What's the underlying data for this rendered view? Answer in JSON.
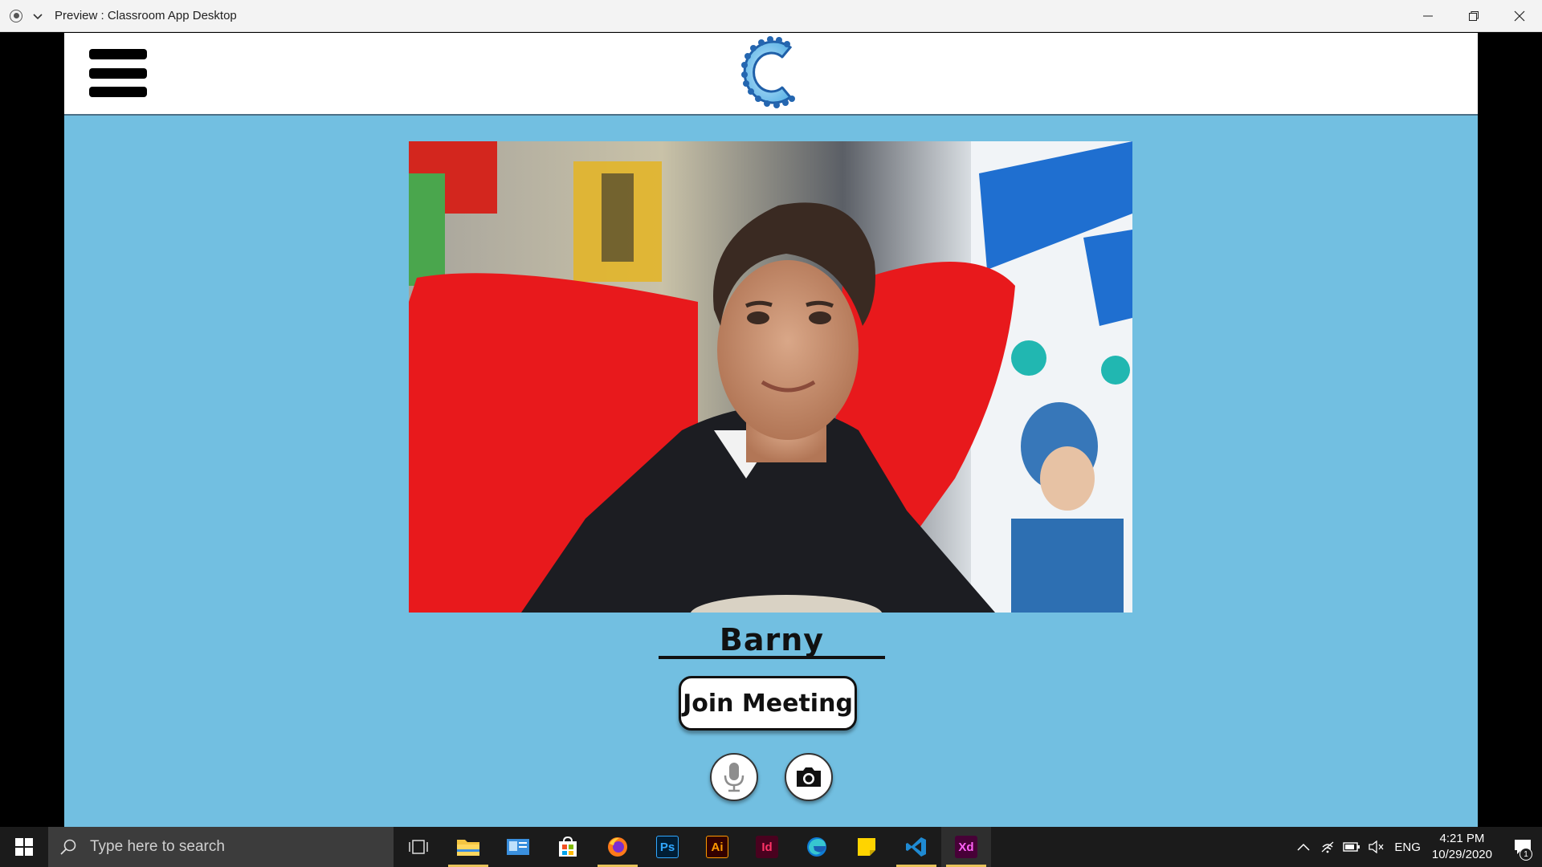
{
  "window": {
    "title": "Preview : Classroom App Desktop"
  },
  "app": {
    "participant_name": "Barny",
    "join_button_label": "Join Meeting",
    "colors": {
      "background": "#72bfe1",
      "header": "#ffffff",
      "logo_blue": "#2f78c4",
      "logo_light": "#7ec6ee"
    },
    "icons": {
      "menu": "hamburger-menu-icon",
      "logo": "classroom-logo",
      "mic": "microphone-icon",
      "camera": "camera-icon"
    }
  },
  "taskbar": {
    "search_placeholder": "Type here to search",
    "apps": [
      {
        "name": "task-view"
      },
      {
        "name": "file-explorer"
      },
      {
        "name": "contacts"
      },
      {
        "name": "store"
      },
      {
        "name": "firefox"
      },
      {
        "name": "photoshop",
        "label": "Ps"
      },
      {
        "name": "illustrator",
        "label": "Ai"
      },
      {
        "name": "indesign",
        "label": "Id"
      },
      {
        "name": "edge"
      },
      {
        "name": "sticky-notes"
      },
      {
        "name": "vscode"
      },
      {
        "name": "adobe-xd",
        "label": "Xd"
      }
    ],
    "language": "ENG",
    "time": "4:21 PM",
    "date": "10/29/2020",
    "notification_count": "1"
  }
}
